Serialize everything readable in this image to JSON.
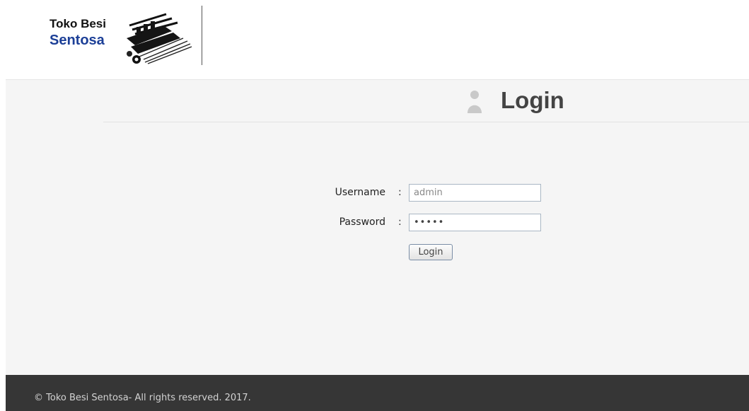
{
  "logo": {
    "line1": "Toko Besi",
    "line2": "Sentosa",
    "brand_color": "#1c3f97",
    "art_icon": "iron-materials-logo-icon"
  },
  "page": {
    "title": "Login",
    "title_icon": "user-icon"
  },
  "form": {
    "username_label": "Username",
    "username_value": "admin",
    "password_label": "Password",
    "password_value": "•••••",
    "colon": ":",
    "submit_label": "Login"
  },
  "footer": {
    "text": "© Toko Besi Sentosa- All rights reserved. 2017."
  },
  "colors": {
    "main_background": "#f5f5f5",
    "footer_background": "#363636",
    "title_color": "#444444"
  }
}
